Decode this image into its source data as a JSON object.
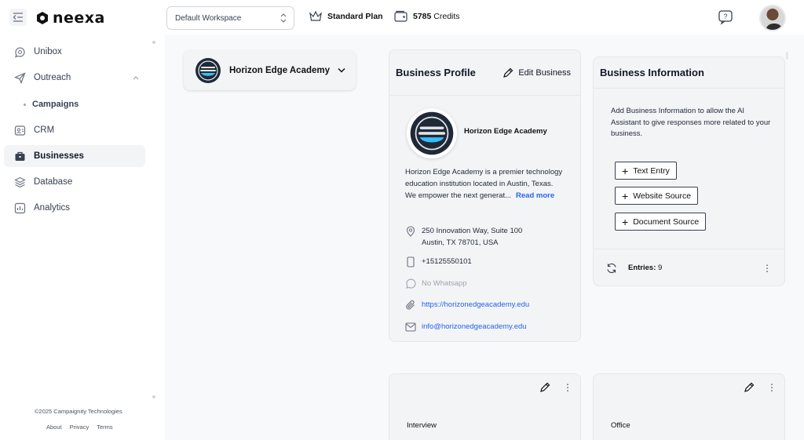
{
  "topbar": {
    "logo_text": "neexa",
    "workspace": "Default Workspace",
    "plan": "Standard Plan",
    "credits_value": "5785",
    "credits_label": "Credits"
  },
  "sidebar": {
    "items": [
      {
        "label": "Unibox",
        "icon": "chat-bubble-icon"
      },
      {
        "label": "Outreach",
        "icon": "send-icon"
      },
      {
        "label": "Campaigns",
        "icon": "dot"
      },
      {
        "label": "CRM",
        "icon": "contacts-icon"
      },
      {
        "label": "Businesses",
        "icon": "briefcase-icon"
      },
      {
        "label": "Database",
        "icon": "layers-icon"
      },
      {
        "label": "Analytics",
        "icon": "analytics-icon"
      }
    ],
    "active": "Businesses",
    "copyright": "©2025 Campaignity Technologies",
    "links": [
      "About",
      "Privacy",
      "Terms"
    ]
  },
  "business_selector": {
    "name": "Horizon Edge Academy"
  },
  "profile": {
    "title": "Business Profile",
    "edit_label": "Edit Business",
    "name": "Horizon Edge Academy",
    "description": "Horizon Edge Academy is a premier technology education institution located in Austin, Texas. We empower the next generat...",
    "read_more": "Read more",
    "address_line1": "250 Innovation Way, Suite 100",
    "address_line2": "Austin, TX 78701, USA",
    "phone": "+15125550101",
    "whatsapp": "No Whatsapp",
    "website": "https://horizonedgeacademy.edu",
    "email": "info@horizonedgeacademy.edu"
  },
  "info": {
    "title": "Business Information",
    "text": "Add Business Information to allow the AI Assistant to give responses more related to your business.",
    "buttons": [
      "Text Entry",
      "Website Source",
      "Document Source"
    ],
    "entries_label": "Entries:",
    "entries_count": "9"
  },
  "locations": [
    {
      "label": "Interview"
    },
    {
      "label": "Office"
    }
  ]
}
